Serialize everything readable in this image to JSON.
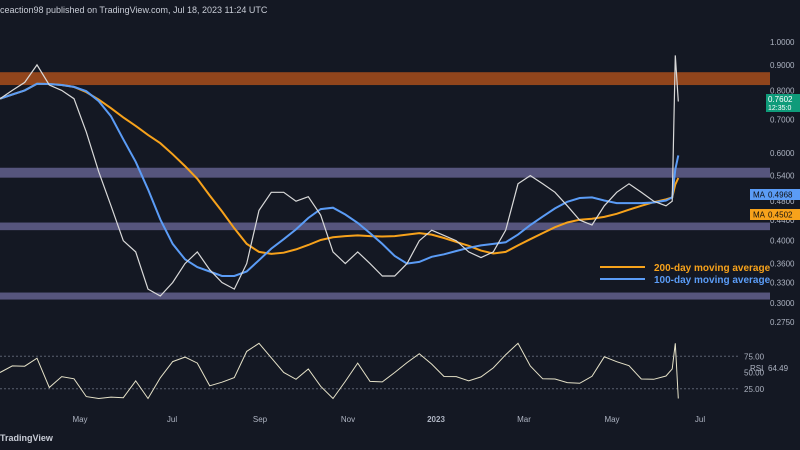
{
  "header": {
    "publisher": "ceaction98 published on TradingView.com, Jul 18, 2023 11:24 UTC"
  },
  "footer": {
    "brand": "TradingView"
  },
  "colors": {
    "background": "#141823",
    "resistance_zone": "#c2571a",
    "support_zone": "#8d88c9",
    "ma200": "#f7a21b",
    "ma100": "#5b9cf6",
    "price": "#d9d9d9",
    "rsi": "#e6e2c8",
    "last_price_badge": "#0f9b7a",
    "axis_text": "#aeb4c2"
  },
  "chart_data": {
    "type": "line",
    "price_axis": {
      "ticks": [
        "1.0000",
        "0.9000",
        "0.8000",
        "0.7000",
        "0.6000",
        "0.5400",
        "0.4800",
        "0.4400",
        "0.4000",
        "0.3600",
        "0.3300",
        "0.3000",
        "0.2750"
      ],
      "scale": "log"
    },
    "time_axis": {
      "labels": [
        "May",
        "Jul",
        "Sep",
        "Nov",
        "2023",
        "Mar",
        "May",
        "Jul"
      ]
    },
    "zones": [
      {
        "kind": "resistance",
        "from": 0.82,
        "to": 0.87
      },
      {
        "kind": "support",
        "from": 0.535,
        "to": 0.56
      },
      {
        "kind": "support",
        "from": 0.42,
        "to": 0.435
      },
      {
        "kind": "support",
        "from": 0.305,
        "to": 0.315
      }
    ],
    "price_series": [
      {
        "t": 0,
        "v": 0.77
      },
      {
        "t": 4,
        "v": 0.8
      },
      {
        "t": 8,
        "v": 0.83
      },
      {
        "t": 12,
        "v": 0.9
      },
      {
        "t": 16,
        "v": 0.82
      },
      {
        "t": 20,
        "v": 0.8
      },
      {
        "t": 24,
        "v": 0.77
      },
      {
        "t": 28,
        "v": 0.66
      },
      {
        "t": 32,
        "v": 0.55
      },
      {
        "t": 36,
        "v": 0.47
      },
      {
        "t": 40,
        "v": 0.4
      },
      {
        "t": 44,
        "v": 0.38
      },
      {
        "t": 48,
        "v": 0.32
      },
      {
        "t": 52,
        "v": 0.31
      },
      {
        "t": 56,
        "v": 0.33
      },
      {
        "t": 60,
        "v": 0.36
      },
      {
        "t": 64,
        "v": 0.38
      },
      {
        "t": 68,
        "v": 0.35
      },
      {
        "t": 72,
        "v": 0.33
      },
      {
        "t": 76,
        "v": 0.32
      },
      {
        "t": 80,
        "v": 0.36
      },
      {
        "t": 84,
        "v": 0.46
      },
      {
        "t": 88,
        "v": 0.5
      },
      {
        "t": 92,
        "v": 0.5
      },
      {
        "t": 96,
        "v": 0.48
      },
      {
        "t": 100,
        "v": 0.49
      },
      {
        "t": 104,
        "v": 0.45
      },
      {
        "t": 108,
        "v": 0.38
      },
      {
        "t": 112,
        "v": 0.36
      },
      {
        "t": 116,
        "v": 0.38
      },
      {
        "t": 120,
        "v": 0.36
      },
      {
        "t": 124,
        "v": 0.34
      },
      {
        "t": 128,
        "v": 0.34
      },
      {
        "t": 132,
        "v": 0.36
      },
      {
        "t": 136,
        "v": 0.4
      },
      {
        "t": 140,
        "v": 0.42
      },
      {
        "t": 144,
        "v": 0.41
      },
      {
        "t": 148,
        "v": 0.4
      },
      {
        "t": 152,
        "v": 0.38
      },
      {
        "t": 156,
        "v": 0.37
      },
      {
        "t": 160,
        "v": 0.38
      },
      {
        "t": 164,
        "v": 0.42
      },
      {
        "t": 168,
        "v": 0.52
      },
      {
        "t": 172,
        "v": 0.54
      },
      {
        "t": 176,
        "v": 0.52
      },
      {
        "t": 180,
        "v": 0.5
      },
      {
        "t": 184,
        "v": 0.47
      },
      {
        "t": 188,
        "v": 0.44
      },
      {
        "t": 192,
        "v": 0.43
      },
      {
        "t": 196,
        "v": 0.47
      },
      {
        "t": 200,
        "v": 0.5
      },
      {
        "t": 204,
        "v": 0.52
      },
      {
        "t": 208,
        "v": 0.5
      },
      {
        "t": 212,
        "v": 0.48
      },
      {
        "t": 216,
        "v": 0.47
      },
      {
        "t": 218,
        "v": 0.48
      },
      {
        "t": 219,
        "v": 0.94
      },
      {
        "t": 220,
        "v": 0.76
      }
    ],
    "series": [
      {
        "name": "200-day moving average",
        "color": "#f7a21b",
        "last_label": "MA",
        "last_value": "0.4502"
      },
      {
        "name": "100-day moving average",
        "color": "#5b9cf6",
        "last_label": "MA",
        "last_value": "0.4968"
      }
    ],
    "last_price": {
      "value": "0.7602",
      "countdown": "12:35:0"
    },
    "rsi": {
      "label": "RSI",
      "value": "64.49",
      "ticks": [
        "75.00",
        "50.00",
        "25.00"
      ],
      "levels": [
        75,
        25
      ]
    }
  }
}
